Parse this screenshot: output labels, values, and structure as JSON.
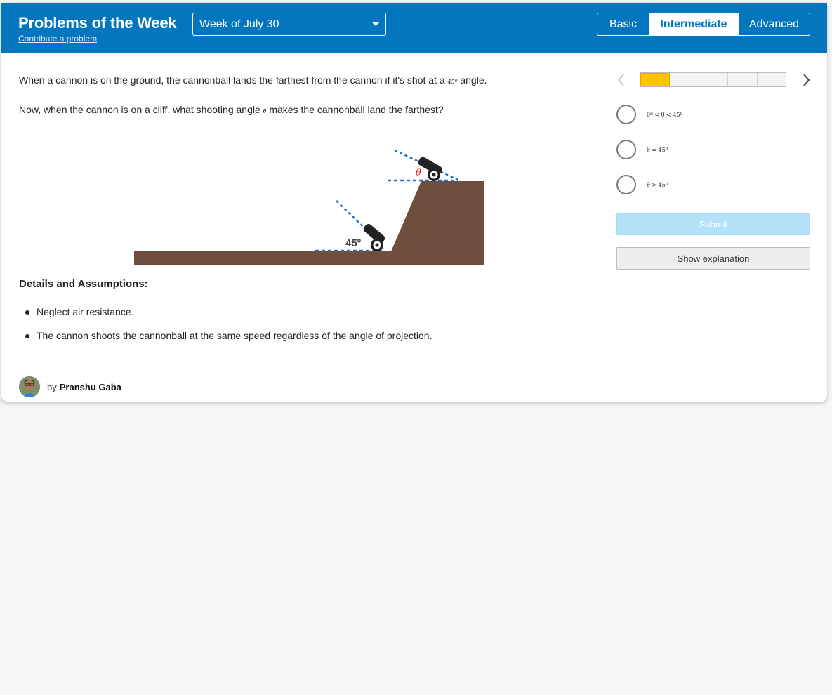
{
  "header": {
    "title": "Problems of the Week",
    "contribute_link": "Contribute a problem",
    "week_select": {
      "selected": "Week of July 30"
    },
    "levels": [
      {
        "label": "Basic",
        "active": false
      },
      {
        "label": "Intermediate",
        "active": true
      },
      {
        "label": "Advanced",
        "active": false
      }
    ],
    "colors": {
      "header_bg": "#0376be",
      "progress_fill": "#ffc400",
      "submit_disabled": "#b5e1f8",
      "cliff": "#6f4e3d",
      "guide_lines": "#1a6fd4",
      "theta_label": "#e02020"
    }
  },
  "problem": {
    "line1_before": "When a cannon is on the ground, the cannonball lands the farthest from the cannon if it's shot at a",
    "line1_math": "45º",
    "line1_after": "angle.",
    "line2_before": "Now, when the cannon is on a cliff, what shooting angle",
    "line2_math": "θ",
    "line2_after": "makes the cannonball land the farthest?",
    "figure": {
      "ground_angle_label": "45º",
      "cliff_angle_label": "θ"
    },
    "details_title": "Details and Assumptions:",
    "assumptions": [
      "Neglect air resistance.",
      "The cannon shoots the cannonball at the same speed regardless of the angle of projection."
    ],
    "author": {
      "by": "by",
      "name": "Pranshu Gaba"
    }
  },
  "sidebar": {
    "progress": {
      "total": 5,
      "completed": 1
    },
    "choices": [
      {
        "label": "0º < θ < 45º"
      },
      {
        "label": "θ = 45º"
      },
      {
        "label": "θ > 45º"
      }
    ],
    "submit_label": "Submit",
    "explanation_label": "Show explanation"
  }
}
